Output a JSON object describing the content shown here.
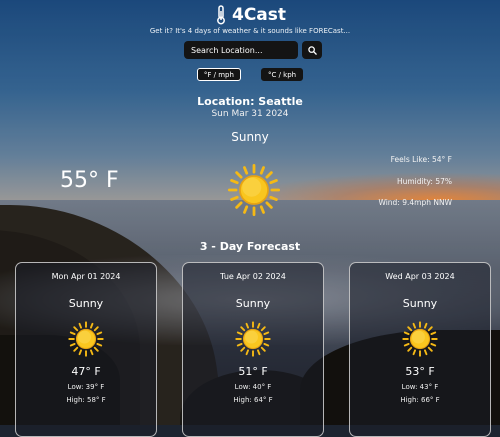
{
  "app": {
    "title": "4Cast",
    "tagline": "Get it? It's 4 days of weather & it sounds like FORECast...",
    "icon": "thermometer-icon"
  },
  "search": {
    "placeholder": "Search Location...",
    "button_icon": "search-icon"
  },
  "units": [
    {
      "label": "°F / mph",
      "active": true
    },
    {
      "label": "°C / kph",
      "active": false
    }
  ],
  "current": {
    "location": "Location: Seattle",
    "date": "Sun Mar 31 2024",
    "condition": "Sunny",
    "temperature": "55° F",
    "icon": "sun-icon",
    "feels_like": "Feels Like: 54° F",
    "humidity": "Humidity: 57%",
    "wind": "Wind: 9.4mph NNW"
  },
  "forecast": {
    "title": "3 - Day Forecast",
    "days": [
      {
        "date": "Mon Apr 01 2024",
        "condition": "Sunny",
        "temp": "47° F",
        "low": "Low: 39° F",
        "high": "High: 58° F",
        "icon": "sun-icon"
      },
      {
        "date": "Tue Apr 02 2024",
        "condition": "Sunny",
        "temp": "51° F",
        "low": "Low: 40° F",
        "high": "High: 64° F",
        "icon": "sun-icon"
      },
      {
        "date": "Wed Apr 03 2024",
        "condition": "Sunny",
        "temp": "53° F",
        "low": "Low: 43° F",
        "high": "High: 66° F",
        "icon": "sun-icon"
      }
    ]
  },
  "colors": {
    "sun": "#f7c21b",
    "control_bg": "#141414"
  }
}
